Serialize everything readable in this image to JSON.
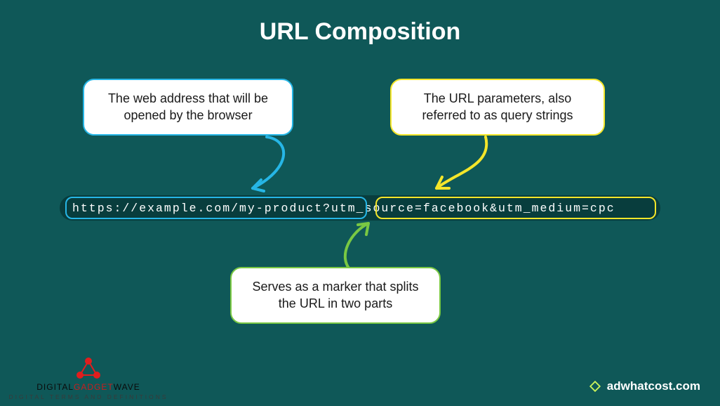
{
  "title": "URL Composition",
  "callouts": {
    "address": "The web address that will be opened by the browser",
    "params": "The URL parameters, also referred to as query strings",
    "marker": "Serves as a marker that splits the URL in two parts"
  },
  "url": {
    "path": "https://example.com/my-product",
    "qmark": "?",
    "query": "utm_source=facebook&utm_medium=cpc"
  },
  "brand_right": "adwhatcost.com",
  "brand_left": {
    "prefix": "DIGITAL",
    "highlight": "GADGET",
    "suffix": "WAVE",
    "tagline": "DIGITAL TERMS AND DEFINITIONS"
  },
  "colors": {
    "bg": "#0f5858",
    "blue": "#26b6e6",
    "yellow": "#f4e62a",
    "green": "#79c843",
    "red": "#e11d1d"
  }
}
